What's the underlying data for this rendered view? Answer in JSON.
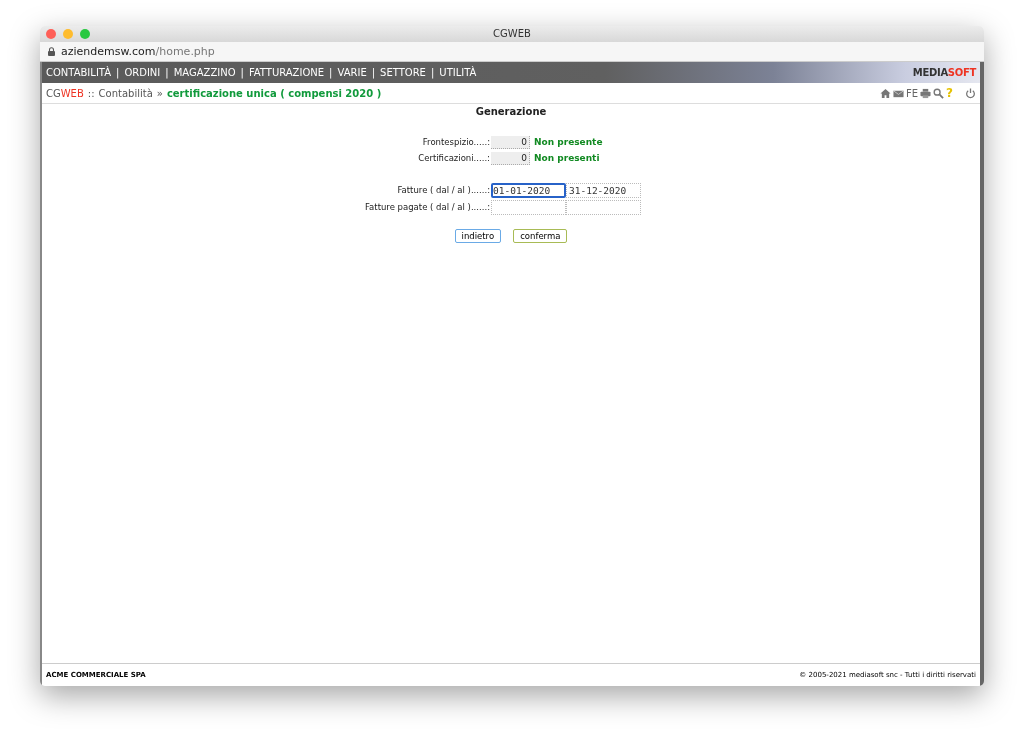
{
  "window": {
    "title": "CGWEB",
    "url_host": "aziendemsw.com",
    "url_path": "/home.php"
  },
  "menu": {
    "separator": "|",
    "items": [
      "CONTABILITÀ",
      "ORDINI",
      "MAGAZZINO",
      "FATTURAZIONE",
      "VARIE",
      "SETTORE",
      "UTILITÀ"
    ]
  },
  "logo": {
    "part_1": "MEDIA",
    "part_2": "SOFT"
  },
  "breadcrumb": {
    "app_part_1": "CG",
    "app_part_2": "WEB",
    "separator_1": "::",
    "section": "Contabilità",
    "separator_2": "»",
    "page": "certificazione unica ( compensi 2020 )"
  },
  "toolbar": {
    "fe_label": "FE",
    "help_label": "?"
  },
  "form": {
    "title": "Generazione",
    "status_rows": [
      {
        "label": "Frontespizio.....:",
        "value": "0",
        "status": "Non presente"
      },
      {
        "label": "Certificazioni.....:",
        "value": "0",
        "status": "Non presenti"
      }
    ],
    "date_rows": [
      {
        "label": "Fatture ( dal / al )......:",
        "from": "01-01-2020",
        "to": "31-12-2020",
        "from_focused": true
      },
      {
        "label": "Fatture pagate ( dal / al )......:",
        "from": "",
        "to": "",
        "from_focused": false
      }
    ],
    "buttons": [
      {
        "label": "indietro",
        "kind": "back"
      },
      {
        "label": "conferma",
        "kind": "confirm"
      }
    ]
  },
  "footer": {
    "company": "ACME COMMERCIALE SPA",
    "copyright": "© 2005-2021 mediasoft snc - Tutti i diritti riservati"
  }
}
